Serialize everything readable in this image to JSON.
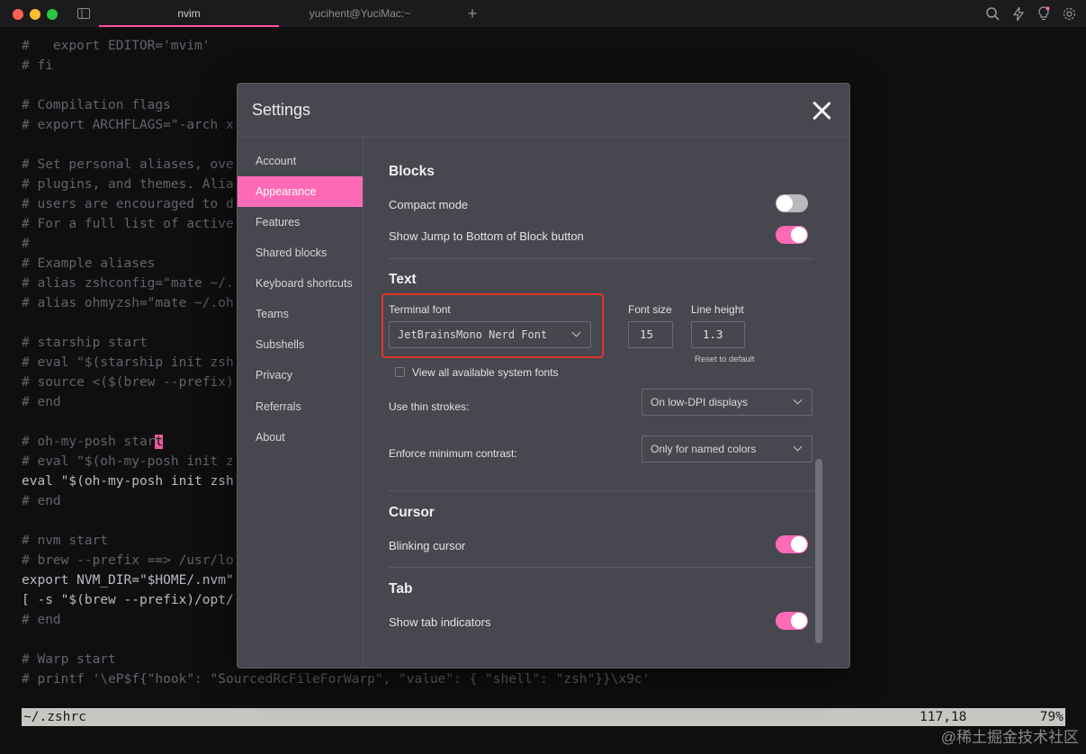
{
  "titlebar": {
    "tabs": [
      {
        "label": "nvim"
      },
      {
        "label": "yucihent@YuciMac:~"
      }
    ],
    "add_tab": "+"
  },
  "terminal": {
    "lines": [
      "#   export EDITOR='mvim'",
      "# fi",
      "",
      "# Compilation flags",
      "# export ARCHFLAGS=\"-arch x",
      "",
      "# Set personal aliases, ove",
      "# plugins, and themes. Alia",
      "# users are encouraged to d",
      "# For a full list of active",
      "#",
      "# Example aliases",
      "# alias zshconfig=\"mate ~/.",
      "# alias ohmyzsh=\"mate ~/.oh",
      "",
      "# starship start",
      "# eval \"$(starship init zsh",
      "# source <($(brew --prefix)",
      "# end",
      "",
      "# oh-my-posh star",
      "# eval \"$(oh-my-posh init z",
      "eval \"$(oh-my-posh init zsh",
      "# end",
      "",
      "# nvm start",
      "# brew --prefix ==> /usr/lo",
      "export NVM_DIR=\"$HOME/.nvm\"",
      "[ -s \"$(brew --prefix)/opt/",
      "# end",
      "",
      "# Warp start",
      "# printf '\\eP$f{\"hook\": \"SourcedRcFileForWarp\", \"value\": { \"shell\": \"zsh\"}}\\x9c'"
    ],
    "cursor_char": "t",
    "status_file": "~/.zshrc",
    "status_position": "117,18",
    "status_percent": "79%"
  },
  "watermark": "@稀土掘金技术社区",
  "settings": {
    "title": "Settings",
    "sidebar": [
      {
        "label": "Account"
      },
      {
        "label": "Appearance"
      },
      {
        "label": "Features"
      },
      {
        "label": "Shared blocks"
      },
      {
        "label": "Keyboard shortcuts"
      },
      {
        "label": "Teams"
      },
      {
        "label": "Subshells"
      },
      {
        "label": "Privacy"
      },
      {
        "label": "Referrals"
      },
      {
        "label": "About"
      }
    ],
    "blocks": {
      "title": "Blocks",
      "compact_mode": "Compact mode",
      "jump_to_bottom": "Show Jump to Bottom of Block button"
    },
    "text": {
      "title": "Text",
      "terminal_font_label": "Terminal font",
      "terminal_font_value": "JetBrainsMono Nerd Font",
      "font_size_label": "Font size",
      "font_size_value": "15",
      "line_height_label": "Line height",
      "line_height_value": "1.3",
      "reset_default": "Reset to default",
      "view_all_fonts": "View all available system fonts",
      "thin_strokes_label": "Use thin strokes:",
      "thin_strokes_value": "On low-DPI displays",
      "min_contrast_label": "Enforce minimum contrast:",
      "min_contrast_value": "Only for named colors"
    },
    "cursor": {
      "title": "Cursor",
      "blinking": "Blinking cursor"
    },
    "tab": {
      "title": "Tab",
      "indicators": "Show tab indicators"
    }
  },
  "colors": {
    "accent": "#ff6ab6",
    "highlight": "#e2352b",
    "modal_bg": "#46474f"
  }
}
